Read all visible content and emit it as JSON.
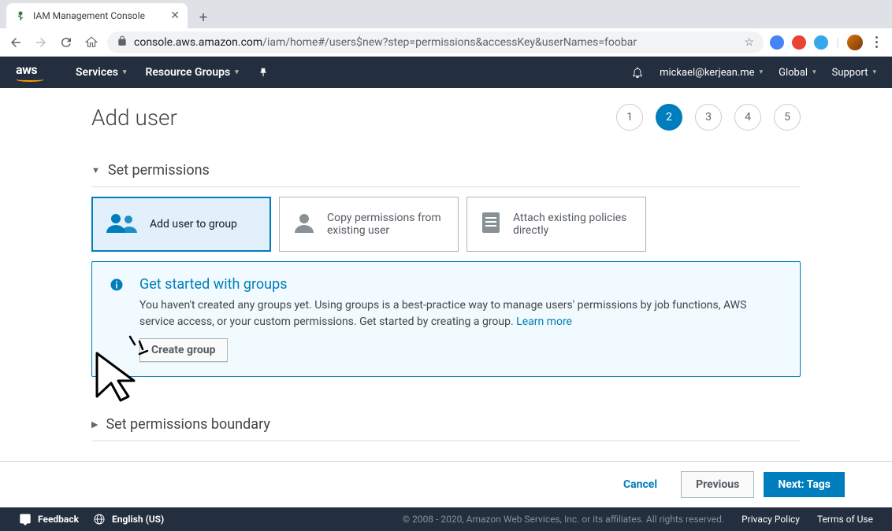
{
  "browser": {
    "tab_title": "IAM Management Console",
    "url_domain": "console.aws.amazon.com",
    "url_path": "/iam/home#/users$new?step=permissions&accessKey&userNames=foobar"
  },
  "aws_header": {
    "services": "Services",
    "resource_groups": "Resource Groups",
    "user_email": "mickael@kerjean.me",
    "region": "Global",
    "support": "Support"
  },
  "page": {
    "title": "Add user",
    "steps": [
      "1",
      "2",
      "3",
      "4",
      "5"
    ],
    "active_step": 2
  },
  "sections": {
    "permissions": {
      "title": "Set permissions",
      "options": [
        {
          "label": "Add user to group"
        },
        {
          "label": "Copy permissions from existing user"
        },
        {
          "label": "Attach existing policies directly"
        }
      ]
    },
    "boundary": {
      "title": "Set permissions boundary"
    }
  },
  "info_box": {
    "title": "Get started with groups",
    "text": "You haven't created any groups yet. Using groups is a best-practice way to manage users' permissions by job functions, AWS service access, or your custom permissions. Get started by creating a group. ",
    "learn_more": "Learn more",
    "create_button": "Create group"
  },
  "actions": {
    "cancel": "Cancel",
    "previous": "Previous",
    "next": "Next: Tags"
  },
  "footer": {
    "feedback": "Feedback",
    "language": "English (US)",
    "copyright": "© 2008 - 2020, Amazon Web Services, Inc. or its affiliates. All rights reserved.",
    "privacy": "Privacy Policy",
    "terms": "Terms of Use"
  }
}
